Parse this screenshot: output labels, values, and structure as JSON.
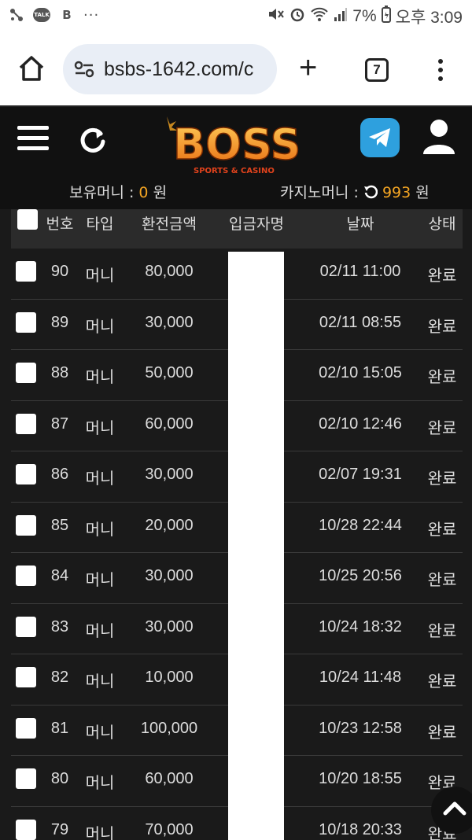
{
  "status_bar": {
    "talk_badge": "TALK",
    "b_icon": "B",
    "more": "···",
    "battery": "7%",
    "time": "오후 3:09"
  },
  "browser": {
    "url": "bsbs-1642.com/c",
    "new_tab": "+",
    "tab_count": "7"
  },
  "site": {
    "logo_text": "BOSS",
    "logo_sub": "SPORTS & CASINO",
    "balance_label": "보유머니 :",
    "balance_value": "0",
    "balance_unit": "원",
    "casino_label": "카지노머니 :",
    "casino_value": "993",
    "casino_unit": "원",
    "accent_color": "#f5a623"
  },
  "table": {
    "headers": {
      "no": "번호",
      "type": "타입",
      "amount": "환전금액",
      "depositor": "입금자명",
      "date": "날짜",
      "status": "상태"
    },
    "rows": [
      {
        "no": "90",
        "type": "머니",
        "amount": "80,000",
        "date": "02/11 11:00",
        "status": "완료"
      },
      {
        "no": "89",
        "type": "머니",
        "amount": "30,000",
        "date": "02/11 08:55",
        "status": "완료"
      },
      {
        "no": "88",
        "type": "머니",
        "amount": "50,000",
        "date": "02/10 15:05",
        "status": "완료"
      },
      {
        "no": "87",
        "type": "머니",
        "amount": "60,000",
        "date": "02/10 12:46",
        "status": "완료"
      },
      {
        "no": "86",
        "type": "머니",
        "amount": "30,000",
        "date": "02/07 19:31",
        "status": "완료"
      },
      {
        "no": "85",
        "type": "머니",
        "amount": "20,000",
        "date": "10/28 22:44",
        "status": "완료"
      },
      {
        "no": "84",
        "type": "머니",
        "amount": "30,000",
        "date": "10/25 20:56",
        "status": "완료"
      },
      {
        "no": "83",
        "type": "머니",
        "amount": "30,000",
        "date": "10/24 18:32",
        "status": "완료"
      },
      {
        "no": "82",
        "type": "머니",
        "amount": "10,000",
        "date": "10/24 11:48",
        "status": "완료"
      },
      {
        "no": "81",
        "type": "머니",
        "amount": "100,000",
        "date": "10/23 12:58",
        "status": "완료"
      },
      {
        "no": "80",
        "type": "머니",
        "amount": "60,000",
        "date": "10/20 18:55",
        "status": "완료"
      },
      {
        "no": "79",
        "type": "머니",
        "amount": "70,000",
        "date": "10/18 20:33",
        "status": "완료"
      }
    ]
  }
}
